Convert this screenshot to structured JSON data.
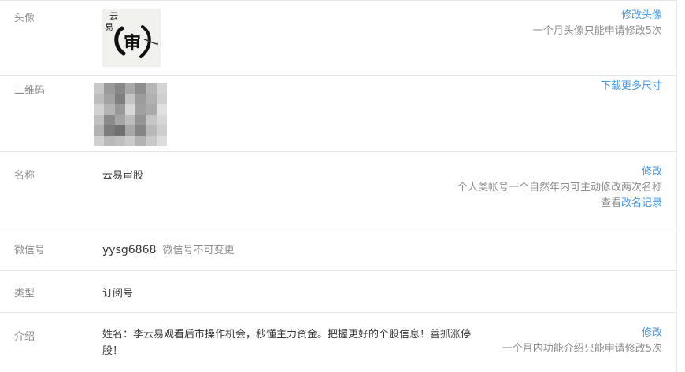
{
  "avatar": {
    "label": "头像",
    "action": "修改头像",
    "hint": "一个月头像只能申请修改5次",
    "logo_text_top": "云",
    "logo_text_side": "易",
    "logo_text_main": "审"
  },
  "qr": {
    "label": "二维码",
    "action": "下载更多尺寸"
  },
  "name": {
    "label": "名称",
    "value": "云易审股",
    "action": "修改",
    "hint": "个人类帐号一个自然年内可主动修改两次名称",
    "record_prefix": "查看",
    "record_link": "改名记录"
  },
  "wechat_id": {
    "label": "微信号",
    "value": "yysg6868",
    "note": "微信号不可变更"
  },
  "type": {
    "label": "类型",
    "value": "订阅号"
  },
  "intro": {
    "label": "介绍",
    "value": "姓名：李云易观看后市操作机会，秒懂主力资金。把握更好的个股信息！善抓涨停股！",
    "action": "修改",
    "hint": "一个月内功能介绍只能申请修改5次"
  },
  "colors": {
    "link": "#459ae9",
    "label": "#8d8d8d",
    "text": "#353535",
    "divider": "#e7e7eb"
  }
}
